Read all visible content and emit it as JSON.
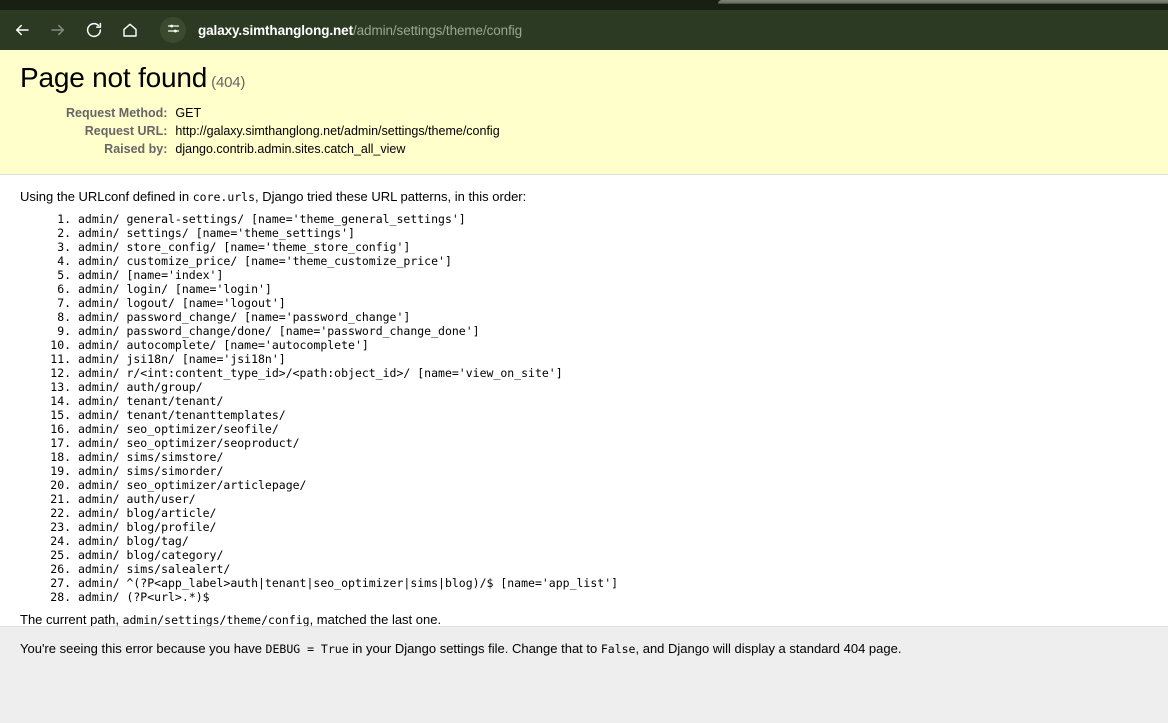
{
  "browser": {
    "nav": {
      "back_label": "Back",
      "forward_label": "Forward",
      "reload_label": "Reload this page",
      "home_label": "Home"
    },
    "omnibox": {
      "site_info_label": "View site information",
      "url_domain": "galaxy.simthanglong.net",
      "url_path": "/admin/settings/theme/config"
    },
    "colors": {
      "toolbar_bg": "#2c3a23",
      "tabstrip_bg": "#182014",
      "url_domain_color": "#ffffff",
      "url_path_color": "#9aa692"
    }
  },
  "page": {
    "title": "Page not found",
    "status_code": "(404)",
    "summary_bg": "#ffffcc",
    "meta": [
      {
        "label": "Request Method:",
        "value": "GET"
      },
      {
        "label": "Request URL:",
        "value": "http://galaxy.simthanglong.net/admin/settings/theme/config"
      },
      {
        "label": "Raised by:",
        "value": "django.contrib.admin.sites.catch_all_view"
      }
    ],
    "explanation": {
      "intro_before": "Using the URLconf defined in ",
      "intro_code": "core.urls",
      "intro_after": ", Django tried these URL patterns, in this order:",
      "urlpatterns": [
        "admin/ general-settings/ [name='theme_general_settings']",
        "admin/ settings/ [name='theme_settings']",
        "admin/ store_config/ [name='theme_store_config']",
        "admin/ customize_price/ [name='theme_customize_price']",
        "admin/ [name='index']",
        "admin/ login/ [name='login']",
        "admin/ logout/ [name='logout']",
        "admin/ password_change/ [name='password_change']",
        "admin/ password_change/done/ [name='password_change_done']",
        "admin/ autocomplete/ [name='autocomplete']",
        "admin/ jsi18n/ [name='jsi18n']",
        "admin/ r/<int:content_type_id>/<path:object_id>/ [name='view_on_site']",
        "admin/ auth/group/",
        "admin/ tenant/tenant/",
        "admin/ tenant/tenanttemplates/",
        "admin/ seo_optimizer/seofile/",
        "admin/ seo_optimizer/seoproduct/",
        "admin/ sims/simstore/",
        "admin/ sims/simorder/",
        "admin/ seo_optimizer/articlepage/",
        "admin/ auth/user/",
        "admin/ blog/article/",
        "admin/ blog/profile/",
        "admin/ blog/tag/",
        "admin/ blog/category/",
        "admin/ sims/salealert/",
        "admin/ ^(?P<app_label>auth|tenant|seo_optimizer|sims|blog)/$ [name='app_list']",
        "admin/ (?P<url>.*)$"
      ],
      "current_path_before": "The current path, ",
      "current_path_code": "admin/settings/theme/config",
      "current_path_after": ", matched the last one."
    },
    "footer": {
      "before_debug": "You're seeing this error because you have ",
      "debug_code": "DEBUG = True",
      "middle": " in your Django settings file. Change that to ",
      "false_code": "False",
      "after": ", and Django will display a standard 404 page."
    }
  }
}
